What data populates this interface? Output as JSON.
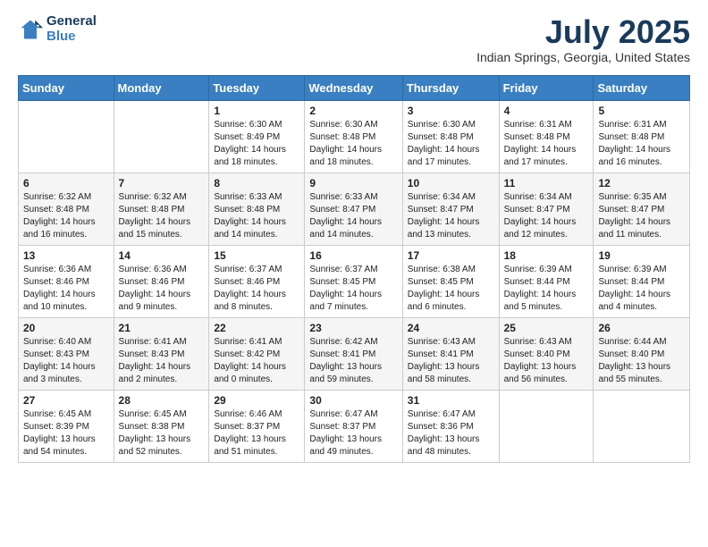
{
  "header": {
    "logo_general": "General",
    "logo_blue": "Blue",
    "title": "July 2025",
    "location": "Indian Springs, Georgia, United States"
  },
  "weekdays": [
    "Sunday",
    "Monday",
    "Tuesday",
    "Wednesday",
    "Thursday",
    "Friday",
    "Saturday"
  ],
  "weeks": [
    [
      {
        "day": "",
        "content": ""
      },
      {
        "day": "",
        "content": ""
      },
      {
        "day": "1",
        "content": "Sunrise: 6:30 AM\nSunset: 8:49 PM\nDaylight: 14 hours\nand 18 minutes."
      },
      {
        "day": "2",
        "content": "Sunrise: 6:30 AM\nSunset: 8:48 PM\nDaylight: 14 hours\nand 18 minutes."
      },
      {
        "day": "3",
        "content": "Sunrise: 6:30 AM\nSunset: 8:48 PM\nDaylight: 14 hours\nand 17 minutes."
      },
      {
        "day": "4",
        "content": "Sunrise: 6:31 AM\nSunset: 8:48 PM\nDaylight: 14 hours\nand 17 minutes."
      },
      {
        "day": "5",
        "content": "Sunrise: 6:31 AM\nSunset: 8:48 PM\nDaylight: 14 hours\nand 16 minutes."
      }
    ],
    [
      {
        "day": "6",
        "content": "Sunrise: 6:32 AM\nSunset: 8:48 PM\nDaylight: 14 hours\nand 16 minutes."
      },
      {
        "day": "7",
        "content": "Sunrise: 6:32 AM\nSunset: 8:48 PM\nDaylight: 14 hours\nand 15 minutes."
      },
      {
        "day": "8",
        "content": "Sunrise: 6:33 AM\nSunset: 8:48 PM\nDaylight: 14 hours\nand 14 minutes."
      },
      {
        "day": "9",
        "content": "Sunrise: 6:33 AM\nSunset: 8:47 PM\nDaylight: 14 hours\nand 14 minutes."
      },
      {
        "day": "10",
        "content": "Sunrise: 6:34 AM\nSunset: 8:47 PM\nDaylight: 14 hours\nand 13 minutes."
      },
      {
        "day": "11",
        "content": "Sunrise: 6:34 AM\nSunset: 8:47 PM\nDaylight: 14 hours\nand 12 minutes."
      },
      {
        "day": "12",
        "content": "Sunrise: 6:35 AM\nSunset: 8:47 PM\nDaylight: 14 hours\nand 11 minutes."
      }
    ],
    [
      {
        "day": "13",
        "content": "Sunrise: 6:36 AM\nSunset: 8:46 PM\nDaylight: 14 hours\nand 10 minutes."
      },
      {
        "day": "14",
        "content": "Sunrise: 6:36 AM\nSunset: 8:46 PM\nDaylight: 14 hours\nand 9 minutes."
      },
      {
        "day": "15",
        "content": "Sunrise: 6:37 AM\nSunset: 8:46 PM\nDaylight: 14 hours\nand 8 minutes."
      },
      {
        "day": "16",
        "content": "Sunrise: 6:37 AM\nSunset: 8:45 PM\nDaylight: 14 hours\nand 7 minutes."
      },
      {
        "day": "17",
        "content": "Sunrise: 6:38 AM\nSunset: 8:45 PM\nDaylight: 14 hours\nand 6 minutes."
      },
      {
        "day": "18",
        "content": "Sunrise: 6:39 AM\nSunset: 8:44 PM\nDaylight: 14 hours\nand 5 minutes."
      },
      {
        "day": "19",
        "content": "Sunrise: 6:39 AM\nSunset: 8:44 PM\nDaylight: 14 hours\nand 4 minutes."
      }
    ],
    [
      {
        "day": "20",
        "content": "Sunrise: 6:40 AM\nSunset: 8:43 PM\nDaylight: 14 hours\nand 3 minutes."
      },
      {
        "day": "21",
        "content": "Sunrise: 6:41 AM\nSunset: 8:43 PM\nDaylight: 14 hours\nand 2 minutes."
      },
      {
        "day": "22",
        "content": "Sunrise: 6:41 AM\nSunset: 8:42 PM\nDaylight: 14 hours\nand 0 minutes."
      },
      {
        "day": "23",
        "content": "Sunrise: 6:42 AM\nSunset: 8:41 PM\nDaylight: 13 hours\nand 59 minutes."
      },
      {
        "day": "24",
        "content": "Sunrise: 6:43 AM\nSunset: 8:41 PM\nDaylight: 13 hours\nand 58 minutes."
      },
      {
        "day": "25",
        "content": "Sunrise: 6:43 AM\nSunset: 8:40 PM\nDaylight: 13 hours\nand 56 minutes."
      },
      {
        "day": "26",
        "content": "Sunrise: 6:44 AM\nSunset: 8:40 PM\nDaylight: 13 hours\nand 55 minutes."
      }
    ],
    [
      {
        "day": "27",
        "content": "Sunrise: 6:45 AM\nSunset: 8:39 PM\nDaylight: 13 hours\nand 54 minutes."
      },
      {
        "day": "28",
        "content": "Sunrise: 6:45 AM\nSunset: 8:38 PM\nDaylight: 13 hours\nand 52 minutes."
      },
      {
        "day": "29",
        "content": "Sunrise: 6:46 AM\nSunset: 8:37 PM\nDaylight: 13 hours\nand 51 minutes."
      },
      {
        "day": "30",
        "content": "Sunrise: 6:47 AM\nSunset: 8:37 PM\nDaylight: 13 hours\nand 49 minutes."
      },
      {
        "day": "31",
        "content": "Sunrise: 6:47 AM\nSunset: 8:36 PM\nDaylight: 13 hours\nand 48 minutes."
      },
      {
        "day": "",
        "content": ""
      },
      {
        "day": "",
        "content": ""
      }
    ]
  ]
}
